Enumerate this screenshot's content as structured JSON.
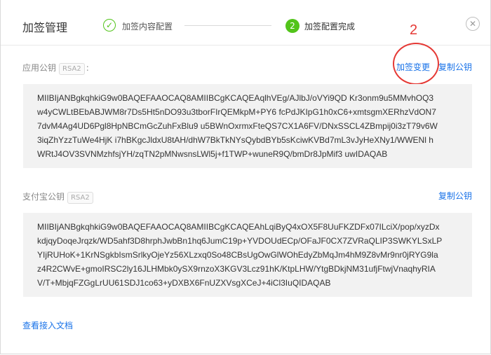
{
  "dialog": {
    "title": "加签管理",
    "steps": [
      {
        "label": "加签内容配置",
        "icon": "check-icon"
      },
      {
        "label": "加签配置完成",
        "number": "2"
      }
    ],
    "close_icon": "close-icon"
  },
  "annotation": {
    "number": "2",
    "color": "#e53935"
  },
  "app_public_key": {
    "label": "应用公钥",
    "badge": "RSA2",
    "change_link": "加签变更",
    "copy_link": "复制公钥",
    "lines": [
      "MIIBIjANBgkqhkiG9w0BAQEFAAOCAQ8AMIIBCgKCAQEAqlhVEg/AJlbJ/oVYi9QD Kr3onm9u5MMvhOQ3",
      "w4yCWLtBEbABJWM8r7Ds5Ht5nDO93u3tborFIrQEMkpM+PY6 fcPdJKIpG1h0xC6+xmtsgmXERhzVdON7",
      "7dvM4Ag4UD6Pgl8HpNBCmGcZuhFxBlu9 u5BWnOxrmxFteQS7CX1A6FV/DNxSSCL4ZBmpij0i3zT79v6W",
      "3iqZhYzzTuWe4HjK i7hBKgcJldxU8tAH/dhW7BkTkNYsQybdBYb5sKciwKVBd7mL3vJyHeXNy1/WWENl h",
      "WRtJ4OV3SVNMzhfsjYH/zqTN2pMNwsnsLWl5j+f1TWP+wuneR9Q/bmDr8JpMif3 uwIDAQAB"
    ]
  },
  "alipay_public_key": {
    "label": "支付宝公钥",
    "badge": "RSA2",
    "copy_link": "复制公钥",
    "lines": [
      "MIIBIjANBgkqhkiG9w0BAQEFAAOCAQ8AMIIBCgKCAQEAhLqiByQ4xOX5F8UuFKZDFx07ILciX/pop/xyzDx",
      "kdjqyDoqeJrqzk/WD5ahf3D8hrphJwbBn1hq6JumC19p+YVDOUdECp/OFaJF0CX7ZVRaQLIP3SWKYLSxLP",
      "YIjRUHoK+1KrNSgkbIsmSrlkyOjeYz56XLzxq0So48CBsUgOwGlWOhEdyZbMqJm4hM9Z8vMr9nr0jRYG9la",
      "z4R2CWvE+gmoIRSC2ly16JLHMbk0ySX9rnzoX3KGV3Lcz91hK/KtpLHW/YtgBDkjNM31ufjFtwjVnaqhyRIA",
      "V/T+MbjqFZGgLrUU61SDJ1co63+yDXBX6FnUZXVsgXCeJ+4iCl3IuQIDAQAB"
    ]
  },
  "docs_link": "查看接入文档",
  "colors": {
    "accent": "#1a73e8",
    "success": "#52c41a"
  }
}
